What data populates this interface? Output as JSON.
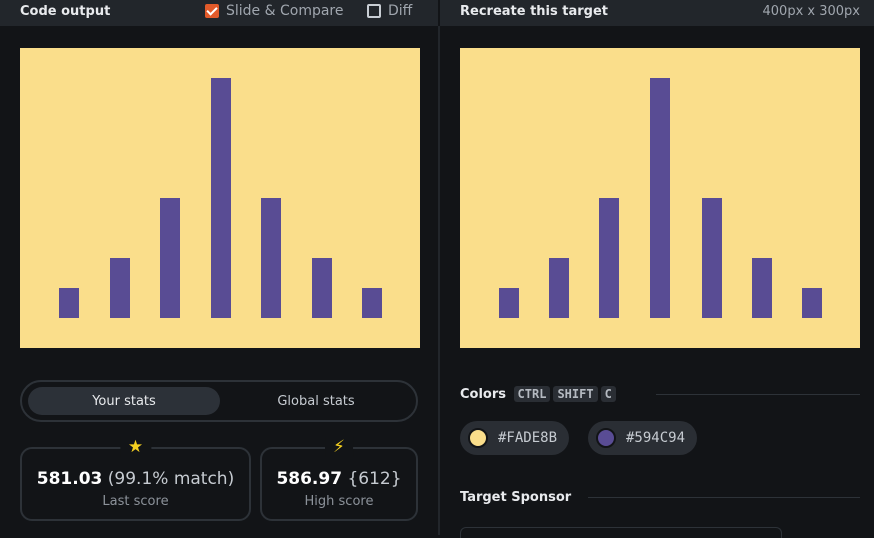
{
  "header": {
    "left_title": "Code output",
    "slide_compare_label": "Slide & Compare",
    "slide_compare_checked": true,
    "diff_label": "Diff",
    "diff_checked": false,
    "right_title": "Recreate this target",
    "size_label": "400px x 300px"
  },
  "canvas_colors": {
    "background": "#FADE8B",
    "bars": "#594C94"
  },
  "stats": {
    "tabs": [
      "Your stats",
      "Global stats"
    ],
    "active_tab": "Your stats",
    "last": {
      "score": "581.03",
      "match": "(99.1% match)",
      "caption": "Last score",
      "icon": "star-icon"
    },
    "high": {
      "score": "586.97",
      "extra": "{612}",
      "caption": "High score",
      "icon": "lightning-icon"
    }
  },
  "colors_section": {
    "title": "Colors",
    "shortcut": [
      "CTRL",
      "SHIFT",
      "C"
    ],
    "swatches": [
      {
        "hex": "#FADE8B",
        "label": "#FADE8B"
      },
      {
        "hex": "#594C94",
        "label": "#594C94"
      }
    ]
  },
  "sponsor": {
    "title": "Target Sponsor"
  }
}
